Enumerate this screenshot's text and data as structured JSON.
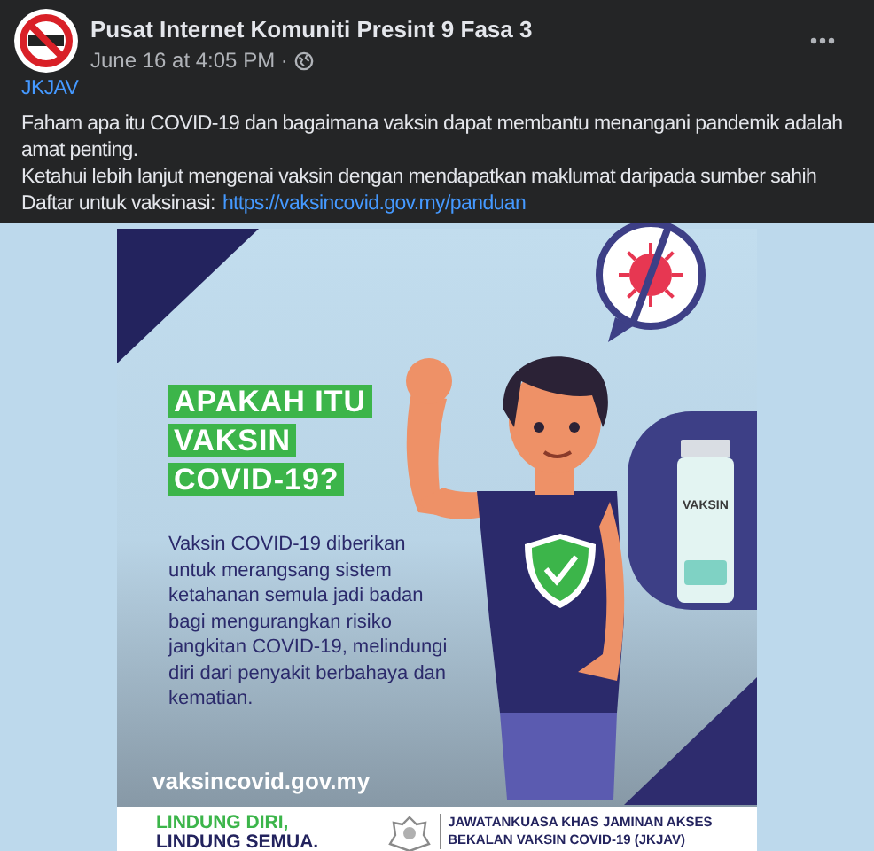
{
  "post": {
    "author": "Pusat Internet Komuniti Presint 9 Fasa 3",
    "timestamp": "June 16 at 4:05 PM ·",
    "hashtag": "JKJAV",
    "paragraphs": [
      "Faham apa itu COVID-19 dan bagaimana vaksin dapat membantu menangani pandemik adalah amat penting.",
      "Ketahui lebih lanjut mengenai vaksin dengan mendapatkan maklumat daripada sumber sahih"
    ],
    "link_line": {
      "text": "Daftar untuk vaksinasi:",
      "url": "https://vaksincovid.gov.my/panduan"
    }
  },
  "poster": {
    "title_lines": [
      "APAKAH ITU",
      "VAKSIN",
      "COVID-19?"
    ],
    "vial_label": "VAKSIN",
    "body": "Vaksin COVID-19 diberikan untuk merangsang sistem ketahanan semula jadi badan bagi mengurangkan risiko jangkitan COVID-19, melindungi diri dari penyakit berbahaya dan kematian.",
    "website": "vaksincovid.gov.my",
    "slogan_lines": [
      "LINDUNG DIRI,",
      "LINDUNG SEMUA."
    ],
    "committee_lines": [
      "JAWATANKUASA KHAS JAMINAN AKSES",
      "BEKALAN VAKSIN COVID-19 (JKJAV)"
    ]
  }
}
